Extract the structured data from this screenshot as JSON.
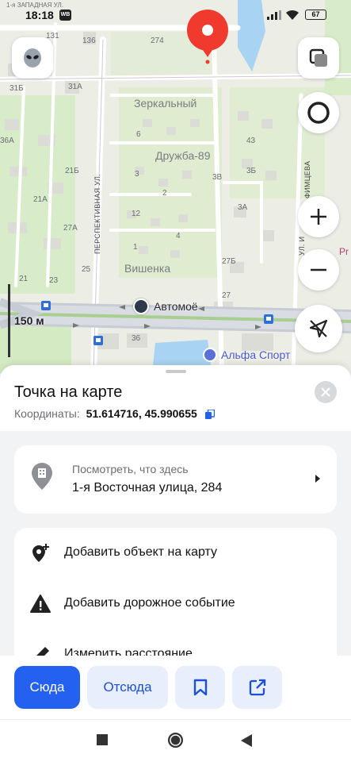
{
  "status_bar": {
    "time": "18:18",
    "notif_app": "WB",
    "battery": "67"
  },
  "map": {
    "street_top": "1-я ЗАПАДНАЯ УЛ.",
    "labels": {
      "zerkalny": "Зеркальный",
      "druzhba": "Дружба-89",
      "vishenka": "Вишенка",
      "perspektivnaya": "ПЕРСПЕКТИВНАЯ УЛ.",
      "fimtseva": "ФИМЦЕВА",
      "ul_right": "УЛ. И",
      "pr": "Pr"
    },
    "house_numbers": [
      "274",
      "136",
      "131",
      "31А",
      "31Б",
      "6",
      "43",
      "36А",
      "21Б",
      "3",
      "3Б",
      "3В",
      "2",
      "21А",
      "4",
      "12",
      "3А",
      "27А",
      "1",
      "27Б",
      "25",
      "27",
      "21",
      "23",
      "36"
    ],
    "pois": {
      "automoe": "Автомоё",
      "alfa_sport": "Альфа Спорт"
    },
    "scale": "150 м"
  },
  "sheet": {
    "title": "Точка на карте",
    "coords_label": "Координаты:",
    "coords_value": "51.614716, 45.990655",
    "what_here_hint": "Посмотреть, что здесь",
    "address": "1-я Восточная улица, 284",
    "actions": [
      {
        "label": "Добавить объект на карту",
        "icon": "map-pin-plus-icon"
      },
      {
        "label": "Добавить дорожное событие",
        "icon": "warning-icon"
      },
      {
        "label": "Измерить расстояние",
        "icon": "ruler-icon"
      }
    ]
  },
  "bottom_buttons": {
    "here": "Сюда",
    "from": "Отсюда"
  },
  "colors": {
    "accent": "#2561f0",
    "pin": "#f03a2e",
    "secondary_btn": "#e8eefb"
  }
}
